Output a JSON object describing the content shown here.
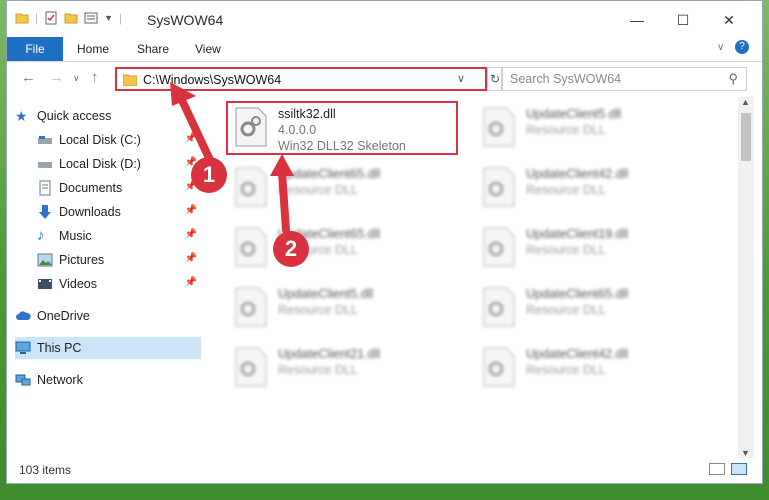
{
  "window": {
    "title": "SysWOW64"
  },
  "ribbon": {
    "tabs": [
      "File",
      "Home",
      "Share",
      "View"
    ]
  },
  "address": {
    "path": "C:\\Windows\\SysWOW64"
  },
  "search": {
    "placeholder": "Search SysWOW64"
  },
  "sidebar": {
    "items": [
      {
        "label": "Quick access",
        "icon": "star-icon"
      },
      {
        "label": "Local Disk (C:)",
        "icon": "drive-icon"
      },
      {
        "label": "Local Disk (D:)",
        "icon": "drive-icon"
      },
      {
        "label": "Documents",
        "icon": "documents-icon"
      },
      {
        "label": "Downloads",
        "icon": "download-icon"
      },
      {
        "label": "Music",
        "icon": "music-icon"
      },
      {
        "label": "Pictures",
        "icon": "pictures-icon"
      },
      {
        "label": "Videos",
        "icon": "videos-icon"
      },
      {
        "label": "OneDrive",
        "icon": "cloud-icon"
      },
      {
        "label": "This PC",
        "icon": "pc-icon"
      },
      {
        "label": "Network",
        "icon": "network-icon"
      }
    ]
  },
  "files": {
    "left": [
      {
        "name": "ssiltk32.dll",
        "line2": "4.0.0.0",
        "line3": "Win32 DLL32 Skeleton"
      },
      {
        "name": "UpdateClient65.dll",
        "line2": "Resource DLL"
      },
      {
        "name": "UpdateClient65.dll",
        "line2": "Resource DLL"
      },
      {
        "name": "UpdateClient5.dll",
        "line2": "Resource DLL"
      },
      {
        "name": "UpdateClient21.dll",
        "line2": "Resource DLL"
      }
    ],
    "right": [
      {
        "name": "UpdateClient5.dll",
        "line2": "Resource DLL"
      },
      {
        "name": "UpdateClient42.dll",
        "line2": "Resource DLL"
      },
      {
        "name": "UpdateClient19.dll",
        "line2": "Resource DLL"
      },
      {
        "name": "UpdateClient65.dll",
        "line2": "Resource DLL"
      },
      {
        "name": "UpdateClient42.dll",
        "line2": "Resource DLL"
      }
    ]
  },
  "status": {
    "item_count": "103 items"
  },
  "annotations": {
    "step1": "1",
    "step2": "2",
    "color": "#d9333f"
  }
}
